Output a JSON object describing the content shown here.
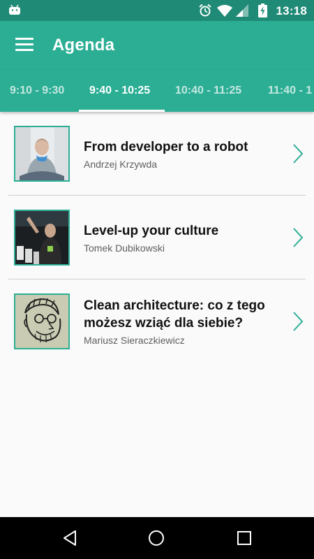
{
  "status_bar": {
    "time": "13:18",
    "icons": [
      "android-icon",
      "alarm-icon",
      "wifi-icon",
      "signal-icon",
      "battery-charging-icon"
    ]
  },
  "app_bar": {
    "title": "Agenda",
    "menu_icon": "hamburger-menu-icon"
  },
  "tabs": [
    {
      "label": "9:10 - 9:30",
      "active": false
    },
    {
      "label": "9:40 - 10:25",
      "active": true
    },
    {
      "label": "10:40 - 11:25",
      "active": false
    },
    {
      "label": "11:40 - 1",
      "active": false
    }
  ],
  "talks": [
    {
      "title": "From developer to a robot",
      "speaker": "Andrzej Krzywda",
      "photo_icon": "speaker-photo"
    },
    {
      "title": "Level-up your culture",
      "speaker": "Tomek Dubikowski",
      "photo_icon": "speaker-photo"
    },
    {
      "title": "Clean architecture: co z tego możesz wziąć dla siebie?",
      "speaker": "Mariusz Sieraczkiewicz",
      "photo_icon": "speaker-sketch"
    }
  ],
  "nav_bar": {
    "icons": [
      "back-icon",
      "home-icon",
      "recents-icon"
    ]
  },
  "colors": {
    "status_bar": "#1f8a76",
    "app_bar": "#2bae94",
    "accent": "#2bae94",
    "background": "#fafafa"
  }
}
